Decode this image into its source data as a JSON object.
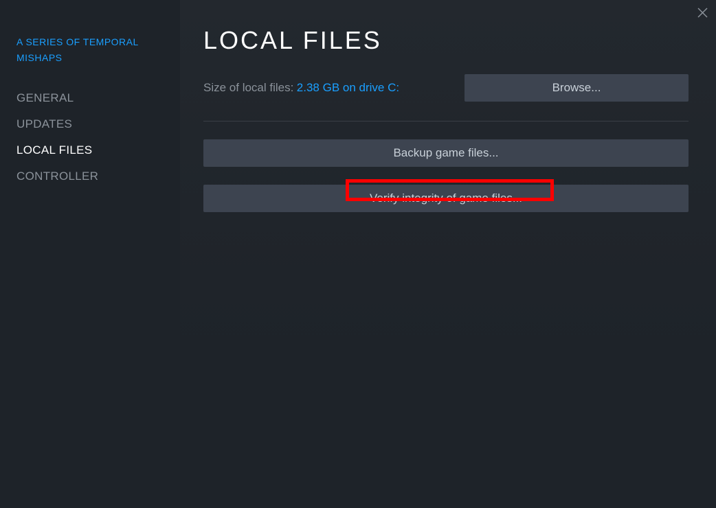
{
  "sidebar": {
    "game_title": "A SERIES OF TEMPORAL MISHAPS",
    "items": [
      {
        "label": "GENERAL",
        "active": false
      },
      {
        "label": "UPDATES",
        "active": false
      },
      {
        "label": "LOCAL FILES",
        "active": true
      },
      {
        "label": "CONTROLLER",
        "active": false
      }
    ]
  },
  "main": {
    "title": "LOCAL FILES",
    "size_label": "Size of local files:",
    "size_value": "2.38 GB on drive C:",
    "browse_label": "Browse...",
    "backup_label": "Backup game files...",
    "verify_label": "Verify integrity of game files..."
  }
}
